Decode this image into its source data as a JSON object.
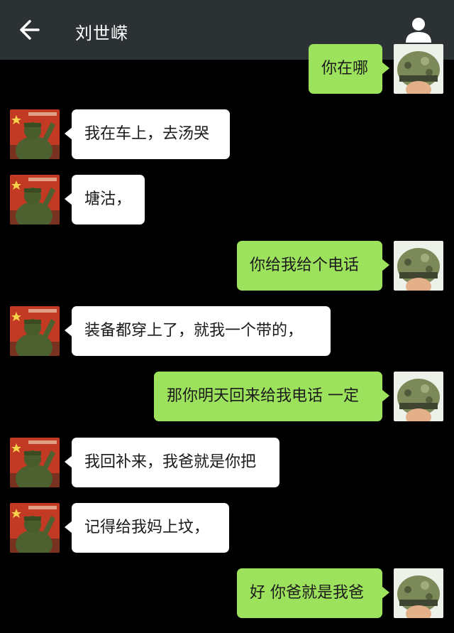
{
  "header": {
    "back_icon": "arrow-left-icon",
    "title": "刘世嵘",
    "profile_icon": "person-icon"
  },
  "colors": {
    "topbar": "#2c3134",
    "background": "#000000",
    "outgoing_bubble": "#9de25c",
    "incoming_bubble": "#ffffff"
  },
  "messages": [
    {
      "side": "out",
      "text": "你在哪"
    },
    {
      "side": "in",
      "text": "我在车上，去汤哭"
    },
    {
      "side": "in",
      "text": "塘沽，"
    },
    {
      "side": "out",
      "text": "你给我给个电话"
    },
    {
      "side": "in",
      "text": "装备都穿上了，就我一个带的，"
    },
    {
      "side": "out",
      "text": "那你明天回来给我电话 一定"
    },
    {
      "side": "in",
      "text": "我回补来，我爸就是你把"
    },
    {
      "side": "in",
      "text": "记得给我妈上坟，"
    },
    {
      "side": "out",
      "text": "好 你爸就是我爸"
    }
  ]
}
